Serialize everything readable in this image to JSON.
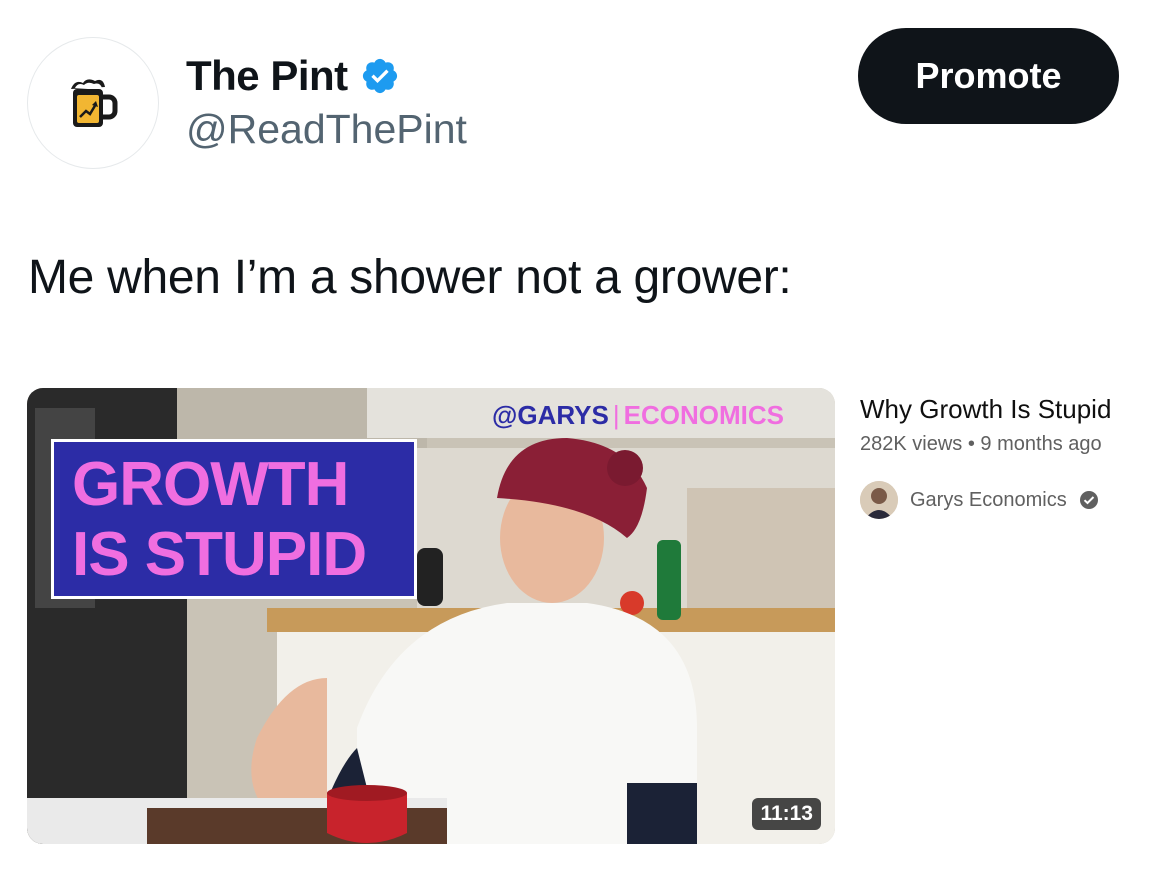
{
  "account": {
    "display_name": "The Pint",
    "handle": "@ReadThePint",
    "verified_icon": "verified-badge-icon",
    "avatar_icon": "beer-mug-chart-icon"
  },
  "actions": {
    "promote_label": "Promote"
  },
  "tweet": {
    "text": "Me when I’m a shower not a grower:"
  },
  "video": {
    "thumbnail_title_line1": "GROWTH",
    "thumbnail_title_line2": "IS STUPID",
    "watermark_part1": "@GARYS",
    "watermark_sep": "|",
    "watermark_part2": "ECONOMICS",
    "duration": "11:13",
    "title": "Why Growth Is Stupid",
    "views": "282K views",
    "meta_sep": "•",
    "age": "9 months ago",
    "channel_name": "Garys Economics",
    "channel_verified_icon": "check-circle-icon"
  },
  "colors": {
    "verified_blue": "#1d9bf0",
    "button_dark": "#0f1419",
    "thumbnail_box": "#2c2ca6",
    "thumbnail_pink": "#f06ee0"
  }
}
